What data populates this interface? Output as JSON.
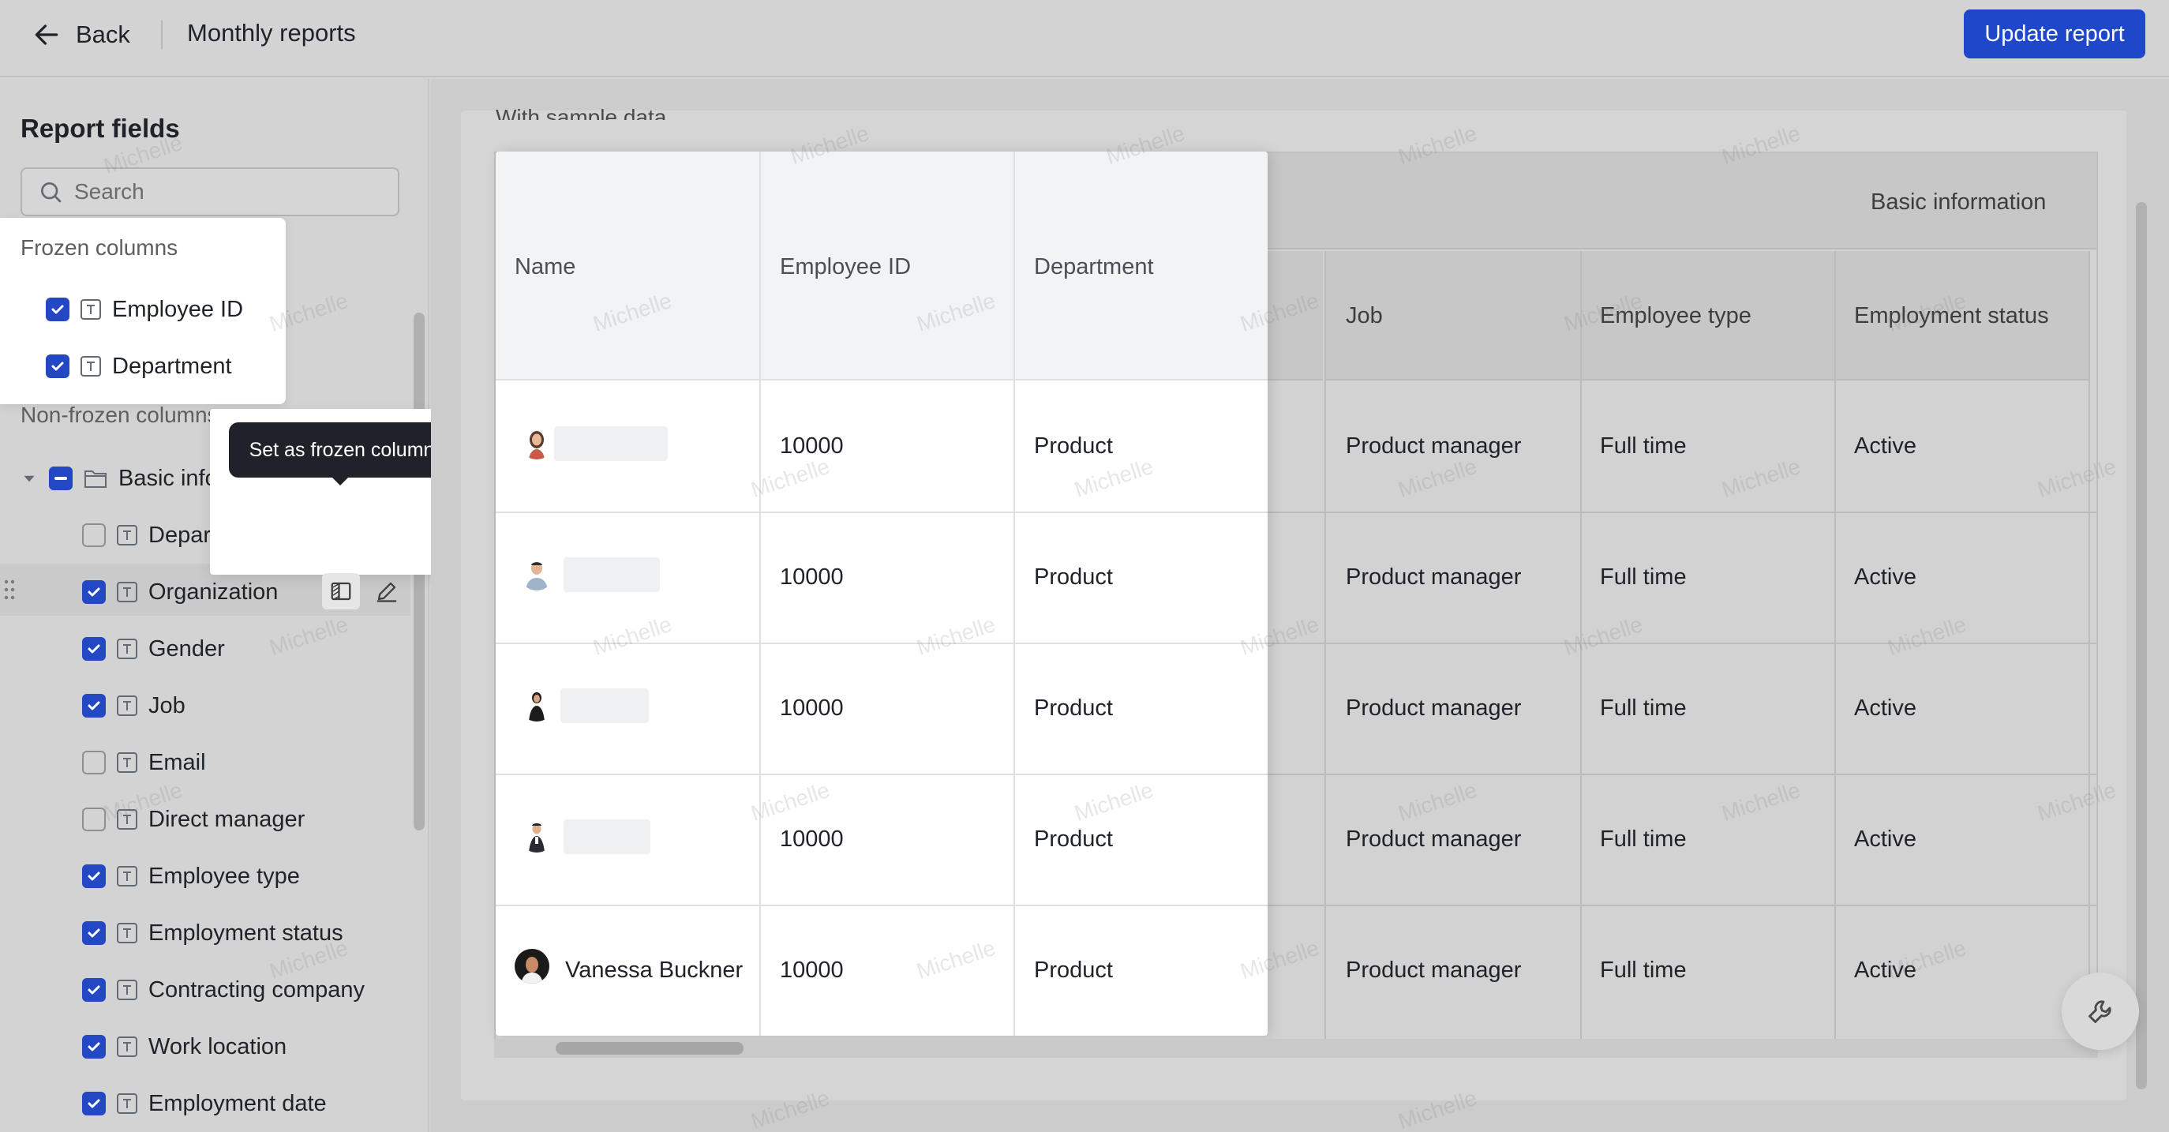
{
  "header": {
    "back_label": "Back",
    "title": "Monthly reports",
    "update_button": "Update report"
  },
  "left_panel": {
    "title": "Report fields",
    "search_placeholder": "Search",
    "frozen_section_label": "Frozen columns",
    "frozen_items": [
      {
        "label": "Employee ID",
        "checked": true
      },
      {
        "label": "Department",
        "checked": true
      }
    ],
    "nonfrozen_section_label": "Non-frozen columns",
    "group": {
      "label": "Basic information",
      "state": "partial",
      "icon": "folder-icon"
    },
    "items": [
      {
        "label": "Department",
        "checked": false
      },
      {
        "label": "Organization",
        "checked": true
      },
      {
        "label": "Gender",
        "checked": true
      },
      {
        "label": "Job",
        "checked": true
      },
      {
        "label": "Email",
        "checked": false
      },
      {
        "label": "Direct manager",
        "checked": false
      },
      {
        "label": "Employee type",
        "checked": true
      },
      {
        "label": "Employment status",
        "checked": true
      },
      {
        "label": "Contracting company",
        "checked": true
      },
      {
        "label": "Work location",
        "checked": true
      },
      {
        "label": "Employment date",
        "checked": true
      }
    ],
    "tooltip": "Set as frozen column"
  },
  "preview": {
    "sample_label": "With sample data",
    "group_header": "Basic information",
    "frozen_columns": [
      "Name",
      "Employee ID",
      "Department"
    ],
    "columns": [
      "Job",
      "Employee type",
      "Employment status"
    ],
    "rows": [
      {
        "name": "",
        "employee_id": "10000",
        "department": "Product",
        "job": "Product manager",
        "employee_type": "Full time",
        "status": "Active"
      },
      {
        "name": "",
        "employee_id": "10000",
        "department": "Product",
        "job": "Product manager",
        "employee_type": "Full time",
        "status": "Active"
      },
      {
        "name": "",
        "employee_id": "10000",
        "department": "Product",
        "job": "Product manager",
        "employee_type": "Full time",
        "status": "Active"
      },
      {
        "name": "",
        "employee_id": "10000",
        "department": "Product",
        "job": "Product manager",
        "employee_type": "Full time",
        "status": "Active"
      },
      {
        "name": "Vanessa Buckner",
        "employee_id": "10000",
        "department": "Product",
        "job": "Product manager",
        "employee_type": "Full time",
        "status": "Active"
      }
    ],
    "watermark": "Michelle"
  },
  "colors": {
    "accent": "#2447c4",
    "button": "#1f47c9",
    "tooltip_bg": "#1f2329"
  }
}
